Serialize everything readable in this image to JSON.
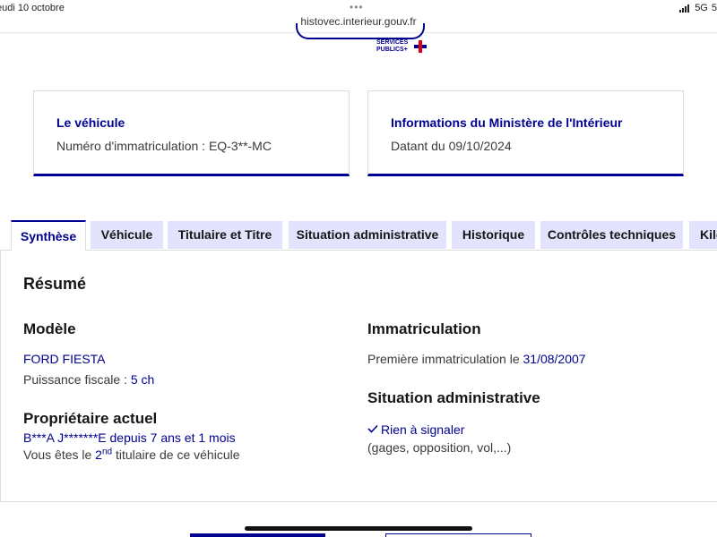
{
  "status_bar": {
    "date": "eudi 10 octobre",
    "url": "histovec.interieur.gouv.fr",
    "network": "5G",
    "battery": "5"
  },
  "header": {
    "logo_line1": "SERVICES",
    "logo_line2": "PUBLICS+"
  },
  "cards": {
    "vehicle": {
      "title": "Le véhicule",
      "text": "Numéro d'immatriculation : EQ-3**-MC"
    },
    "ministry": {
      "title": "Informations du Ministère de l'Intérieur",
      "text": "Datant du 09/10/2024"
    }
  },
  "tabs": [
    {
      "label": "Synthèse",
      "active": true
    },
    {
      "label": "Véhicule"
    },
    {
      "label": "Titulaire et Titre"
    },
    {
      "label": "Situation administrative"
    },
    {
      "label": "Historique"
    },
    {
      "label": "Contrôles techniques"
    },
    {
      "label": "Kilo"
    }
  ],
  "summary": {
    "title": "Résumé",
    "modele": {
      "heading": "Modèle",
      "name": "FORD FIESTA",
      "puissance_label": "Puissance fiscale :",
      "puissance_value": "5 ch"
    },
    "proprietaire": {
      "heading": "Propriétaire actuel",
      "name": "B***A J*******E",
      "depuis_label": "depuis",
      "duration": "7 ans et 1 mois",
      "titulaire_prefix": "Vous êtes le",
      "rank": "2",
      "rank_suffix": "nd",
      "titulaire_suffix": "titulaire de ce véhicule"
    },
    "immatriculation": {
      "heading": "Immatriculation",
      "label": "Première immatriculation le",
      "date": "31/08/2007"
    },
    "situation": {
      "heading": "Situation administrative",
      "status": "Rien à signaler",
      "detail": "(gages, opposition, vol,...)"
    }
  },
  "colors": {
    "brand_blue": "#000091",
    "tab_bg": "#e3e3fd",
    "marianne_red": "#e1000f"
  }
}
